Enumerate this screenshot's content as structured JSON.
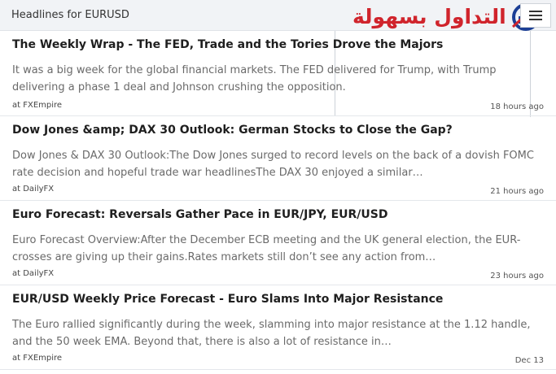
{
  "header": {
    "title": "Headlines for EURUSD",
    "logo_text": "التداول بسهولة",
    "menu_icon": "hamburger-menu-icon",
    "brand_color": "#d0242c",
    "logo_mark_color": "#1c3f95"
  },
  "news": [
    {
      "title": "The Weekly Wrap - The FED, Trade and the Tories Drove the Majors",
      "summary": "It was a big week for the global financial markets. The FED delivered for Trump, with Trump delivering a phase 1 deal and Johnson crushing the opposition.",
      "source": "at FXEmpire",
      "time": "18 hours ago"
    },
    {
      "title": "Dow Jones &amp; DAX 30 Outlook: German Stocks to Close the Gap?",
      "summary": "Dow Jones & DAX 30 Outlook:The Dow Jones surged to record levels on the back of a dovish FOMC rate decision and hopeful trade war headlinesThe DAX 30 enjoyed a similar…",
      "source": "at DailyFX",
      "time": "21 hours ago"
    },
    {
      "title": "Euro Forecast: Reversals Gather Pace in EUR/JPY, EUR/USD",
      "summary": "Euro Forecast Overview:After the December ECB meeting and the UK general election, the EUR-crosses are giving up their gains.Rates markets still don’t see any action from…",
      "source": "at DailyFX",
      "time": "23 hours ago"
    },
    {
      "title": "EUR/USD Weekly Price Forecast - Euro Slams Into Major Resistance",
      "summary": "The Euro rallied significantly during the week, slamming into major resistance at the 1.12 handle, and the 50 week EMA. Beyond that, there is also a lot of resistance in…",
      "source": "at FXEmpire",
      "time": "Dec 13"
    }
  ]
}
